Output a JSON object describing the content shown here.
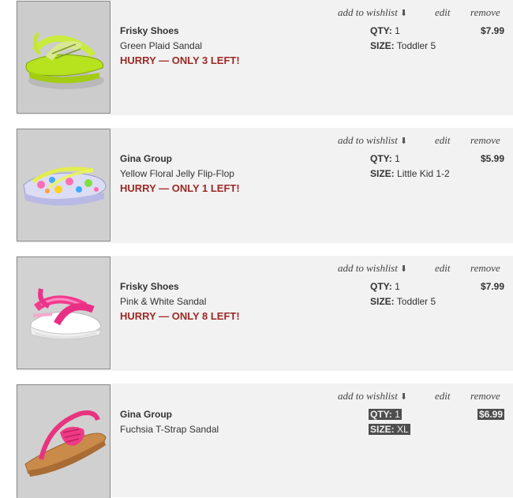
{
  "actions": {
    "wishlist": "add to wishlist",
    "wishlist_arrow": "⬇",
    "edit": "edit",
    "remove": "remove"
  },
  "labels": {
    "qty": "QTY:",
    "size": "SIZE:"
  },
  "items": [
    {
      "brand": "Frisky Shoes",
      "name": "Green Plaid Sandal",
      "urgency": "HURRY — ONLY 3 LEFT!",
      "qty": "1",
      "size": "Toddler 5",
      "price": "$7.99",
      "image_icon": "green-plaid-sandal-image"
    },
    {
      "brand": "Gina Group",
      "name": "Yellow Floral Jelly Flip-Flop",
      "urgency": "HURRY — ONLY 1 LEFT!",
      "qty": "1",
      "size": "Little Kid 1-2",
      "price": "$5.99",
      "image_icon": "yellow-floral-flip-flop-image"
    },
    {
      "brand": "Frisky Shoes",
      "name": "Pink & White Sandal",
      "urgency": "HURRY — ONLY 8 LEFT!",
      "qty": "1",
      "size": "Toddler 5",
      "price": "$7.99",
      "image_icon": "pink-white-sandal-image"
    },
    {
      "brand": "Gina Group",
      "name": "Fuchsia T-Strap Sandal",
      "urgency": "",
      "qty": "1",
      "size": "XL",
      "price": "$6.99",
      "image_icon": "fuchsia-tstrap-sandal-image"
    }
  ],
  "colors": {
    "urgency": "#9b2a26",
    "row_bg": "#f2f2f2",
    "highlight": "#4e4e4e"
  }
}
